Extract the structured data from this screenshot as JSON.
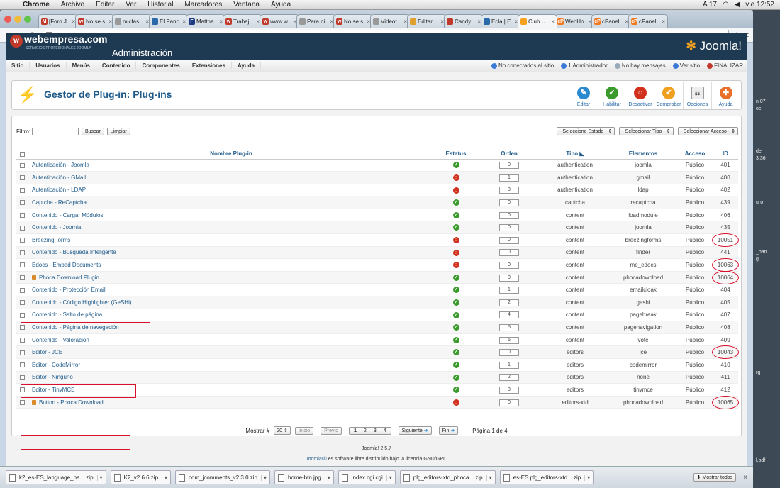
{
  "mac_menu": {
    "app": "Chrome",
    "items": [
      "Archivo",
      "Editar",
      "Ver",
      "Historial",
      "Marcadores",
      "Ventana",
      "Ayuda"
    ],
    "status_right": {
      "a17": "A 17",
      "datetime": "vie 12:52"
    }
  },
  "browser": {
    "tabs": [
      {
        "label": "[Foro J",
        "fav": "M",
        "color": "#c0392b"
      },
      {
        "label": "No se s",
        "fav": "w",
        "color": "#c0392b"
      },
      {
        "label": "micfas",
        "fav": "",
        "color": "#999999"
      },
      {
        "label": "El Panc",
        "fav": "",
        "color": "#2a6aa8"
      },
      {
        "label": "Matthe",
        "fav": "F",
        "color": "#1e3a82"
      },
      {
        "label": "Trabaj",
        "fav": "w",
        "color": "#c0392b"
      },
      {
        "label": "www.w",
        "fav": "w",
        "color": "#c0392b"
      },
      {
        "label": "Para ni",
        "fav": "",
        "color": "#999999"
      },
      {
        "label": "No se s",
        "fav": "w",
        "color": "#c0392b"
      },
      {
        "label": "Videot",
        "fav": "",
        "color": "#999999"
      },
      {
        "label": "Editar",
        "fav": "",
        "color": "#e0a030"
      },
      {
        "label": "Candy",
        "fav": "",
        "color": "#c0392b"
      },
      {
        "label": "Ecla | E",
        "fav": "",
        "color": "#2a6aa8"
      },
      {
        "label": "Club U",
        "fav": "",
        "color": "#f6a21e",
        "active": true
      },
      {
        "label": "WebHo",
        "fav": "cP",
        "color": "#f07820"
      },
      {
        "label": "cPanel",
        "fav": "cP",
        "color": "#f07820"
      },
      {
        "label": "cPanel",
        "fav": "cP",
        "color": "#f07820"
      }
    ],
    "url": "clubunir-cp48.webjoomla.es/administrator/index.php?option=com_plugins"
  },
  "header": {
    "brand": "webempresa.com",
    "brand_sub": "SERVICIOS PROFESIONALES JOOMLA",
    "title": "Administración",
    "logo": "Joomla!"
  },
  "menubar": {
    "items": [
      "Sitio",
      "Usuarios",
      "Menús",
      "Contenido",
      "Componentes",
      "Extensiones",
      "Ayuda"
    ],
    "status": [
      {
        "label": "No conectados al sitio",
        "color": "#3a7bd5"
      },
      {
        "label": "1 Administrador",
        "color": "#3a7bd5"
      },
      {
        "label": "No hay mensajes",
        "color": "#9ab"
      },
      {
        "label": "Ver sitio",
        "color": "#3a7bd5"
      }
    ],
    "finalize": "FINALIZAR"
  },
  "toolbar": {
    "title": "Gestor de Plug-in: Plug-ins",
    "buttons": [
      {
        "label": "Editar",
        "icon": "pencil-icon",
        "glyph": "✎",
        "color": "#2a8ad0"
      },
      {
        "label": "Habilitar",
        "icon": "check-icon",
        "glyph": "✓",
        "color": "#3a9b2c"
      },
      {
        "label": "Desactivar",
        "icon": "disable-icon",
        "glyph": "○",
        "color": "#d0301c"
      },
      {
        "label": "Comprobar",
        "icon": "checkin-icon",
        "glyph": "✔",
        "color": "#f0a020"
      },
      {
        "label": "Opciones",
        "icon": "options-icon",
        "glyph": "☷",
        "color": "#eeeeee"
      },
      {
        "label": "Ayuda",
        "icon": "help-icon",
        "glyph": "✚",
        "color": "#e8702a"
      }
    ]
  },
  "filter": {
    "label": "Filtro:",
    "value": "",
    "search_btn": "Buscar",
    "clear_btn": "Limpiar",
    "selects": [
      "- Seleccione Estado -",
      "- Seleccionar Tipo -",
      "- Seleccionar Acceso -"
    ]
  },
  "table": {
    "headers": {
      "name": "Nombre Plug-in",
      "status": "Estatus",
      "order": "Orden",
      "type": "Tipo",
      "elements": "Elementos",
      "access": "Acceso",
      "id": "ID"
    },
    "rows": [
      {
        "name": "Autenticación - Joomla",
        "on": true,
        "order": "0",
        "type": "authentication",
        "element": "joomla",
        "access": "Público",
        "id": "401"
      },
      {
        "name": "Autenticación - GMail",
        "on": false,
        "order": "1",
        "type": "authentication",
        "element": "gmail",
        "access": "Público",
        "id": "400"
      },
      {
        "name": "Autenticación - LDAP",
        "on": false,
        "order": "3",
        "type": "authentication",
        "element": "ldap",
        "access": "Público",
        "id": "402"
      },
      {
        "name": "Captcha - ReCaptcha",
        "on": true,
        "order": "0",
        "type": "captcha",
        "element": "recaptcha",
        "access": "Público",
        "id": "439"
      },
      {
        "name": "Contenido - Cargar Módulos",
        "on": true,
        "order": "0",
        "type": "content",
        "element": "loadmodule",
        "access": "Público",
        "id": "406"
      },
      {
        "name": "Contenido - Joomla",
        "on": true,
        "order": "0",
        "type": "content",
        "element": "joomla",
        "access": "Público",
        "id": "435"
      },
      {
        "name": "BreezingForms",
        "on": false,
        "order": "0",
        "type": "content",
        "element": "breezingforms",
        "access": "Público",
        "id": "10051",
        "circled": true
      },
      {
        "name": "Contenido - Búsqueda Inteligente",
        "on": false,
        "order": "0",
        "type": "content",
        "element": "finder",
        "access": "Público",
        "id": "441"
      },
      {
        "name": "Edocs - Embed Documents",
        "on": false,
        "order": "0",
        "type": "content",
        "element": "me_edocs",
        "access": "Público",
        "id": "10063",
        "circled": true
      },
      {
        "name": "Phoca Download Plugin",
        "on": true,
        "order": "0",
        "type": "content",
        "element": "phocadownload",
        "access": "Público",
        "id": "10064",
        "circled": true,
        "locked": true
      },
      {
        "name": "Contenido - Protección Email",
        "on": true,
        "order": "1",
        "type": "content",
        "element": "emailcloak",
        "access": "Público",
        "id": "404"
      },
      {
        "name": "Contenido - Código Highlighter (GeSHi)",
        "on": true,
        "order": "2",
        "type": "content",
        "element": "geshi",
        "access": "Público",
        "id": "405"
      },
      {
        "name": "Contenido - Salto de página",
        "on": true,
        "order": "4",
        "type": "content",
        "element": "pagebreak",
        "access": "Público",
        "id": "407"
      },
      {
        "name": "Contenido - Página de navegación",
        "on": true,
        "order": "5",
        "type": "content",
        "element": "pagenavigation",
        "access": "Público",
        "id": "408"
      },
      {
        "name": "Contenido - Valoración",
        "on": true,
        "order": "6",
        "type": "content",
        "element": "vote",
        "access": "Público",
        "id": "409"
      },
      {
        "name": "Editor - JCE",
        "on": true,
        "order": "0",
        "type": "editors",
        "element": "jce",
        "access": "Público",
        "id": "10043",
        "circled": true
      },
      {
        "name": "Editor - CodeMirror",
        "on": true,
        "order": "1",
        "type": "editors",
        "element": "codemirror",
        "access": "Público",
        "id": "410"
      },
      {
        "name": "Editor - Ninguno",
        "on": true,
        "order": "2",
        "type": "editors",
        "element": "none",
        "access": "Público",
        "id": "411"
      },
      {
        "name": "Editor - TinyMCE",
        "on": true,
        "order": "3",
        "type": "editors",
        "element": "tinymce",
        "access": "Público",
        "id": "412"
      },
      {
        "name": "Button - Phoca Download",
        "on": false,
        "order": "0",
        "type": "editors-xtd",
        "element": "phocadownload",
        "access": "Público",
        "id": "10065",
        "circled": true,
        "locked": true
      }
    ]
  },
  "pagination": {
    "show_label": "Mostrar #",
    "show_value": "20",
    "start": "Inicio",
    "prev": "Previo",
    "pages": [
      "1",
      "2",
      "3",
      "4"
    ],
    "next": "Siguiente",
    "end": "Fin",
    "info": "Página 1 de 4"
  },
  "footer": {
    "version": "Joomla! 2.5.7",
    "license_link": "Joomla!®",
    "license_text": " es software libre distribuido bajo la licencia GNU/GPL."
  },
  "downloads": {
    "items": [
      "k2_es-ES_language_pa....zip",
      "K2_v2.6.6.zip",
      "com_jcomments_v2.3.0.zip",
      "home-btn.jpg",
      "index.cgi.cgi",
      "plg_editors-xtd_phoca....zip",
      "es-ES.plg_editors-xtd....zip"
    ],
    "show_all": "Mostrar todas"
  },
  "desktop_labels": [
    "n 07",
    "oc",
    "de",
    "3,36",
    "uro",
    "_pan",
    "g",
    "rg",
    "l.pdf"
  ]
}
